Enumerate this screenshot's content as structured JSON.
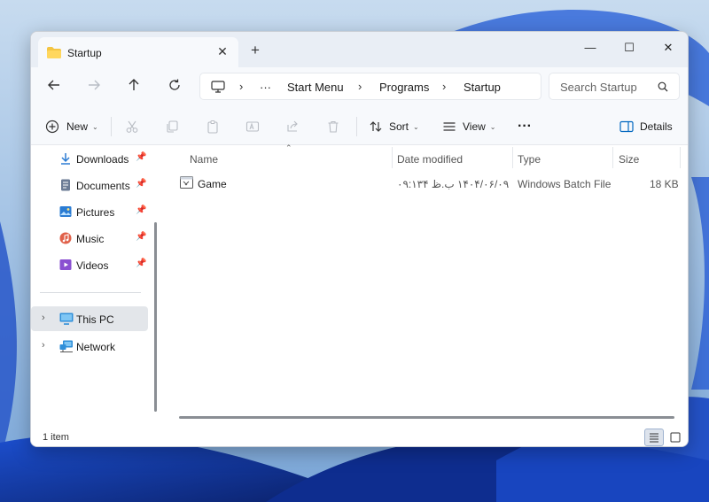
{
  "window": {
    "tab_title": "Startup",
    "tab_close": "✕",
    "new_tab": "+"
  },
  "controls": {
    "minimize": "—",
    "maximize": "☐",
    "close": "✕"
  },
  "address": {
    "overflow": "···",
    "crumbs": [
      "Start Menu",
      "Programs",
      "Startup"
    ],
    "separator": "›"
  },
  "search": {
    "placeholder": "Search Startup"
  },
  "commands": {
    "new": "New",
    "sort": "Sort",
    "view": "View",
    "more": "···",
    "details": "Details"
  },
  "sidebar": {
    "quick_access": [
      {
        "label": "Downloads",
        "icon": "download-icon",
        "color": "#2b7cd3"
      },
      {
        "label": "Documents",
        "icon": "document-icon",
        "color": "#6b7b95"
      },
      {
        "label": "Pictures",
        "icon": "pictures-icon",
        "color": "#2b7cd3"
      },
      {
        "label": "Music",
        "icon": "music-icon",
        "color": "#e0614a"
      },
      {
        "label": "Videos",
        "icon": "video-icon",
        "color": "#8a4fd1"
      }
    ],
    "drives": [
      {
        "label": "This PC",
        "icon": "computer-icon",
        "selected": true
      },
      {
        "label": "Network",
        "icon": "network-icon",
        "selected": false
      }
    ]
  },
  "table": {
    "columns": [
      "Name",
      "Date modified",
      "Type",
      "Size"
    ],
    "rows": [
      {
        "name": "Game",
        "date_modified": "۱۴۰۴/۰۶/۰۹ ب.ظ ۰۹:۱۳۴",
        "type": "Windows Batch File",
        "size": "18 KB"
      }
    ]
  },
  "status": {
    "item_count": "1 item"
  },
  "colors": {
    "accent": "#0067c0",
    "selection": "#e3e6ea",
    "chrome": "#f7f9fc"
  }
}
